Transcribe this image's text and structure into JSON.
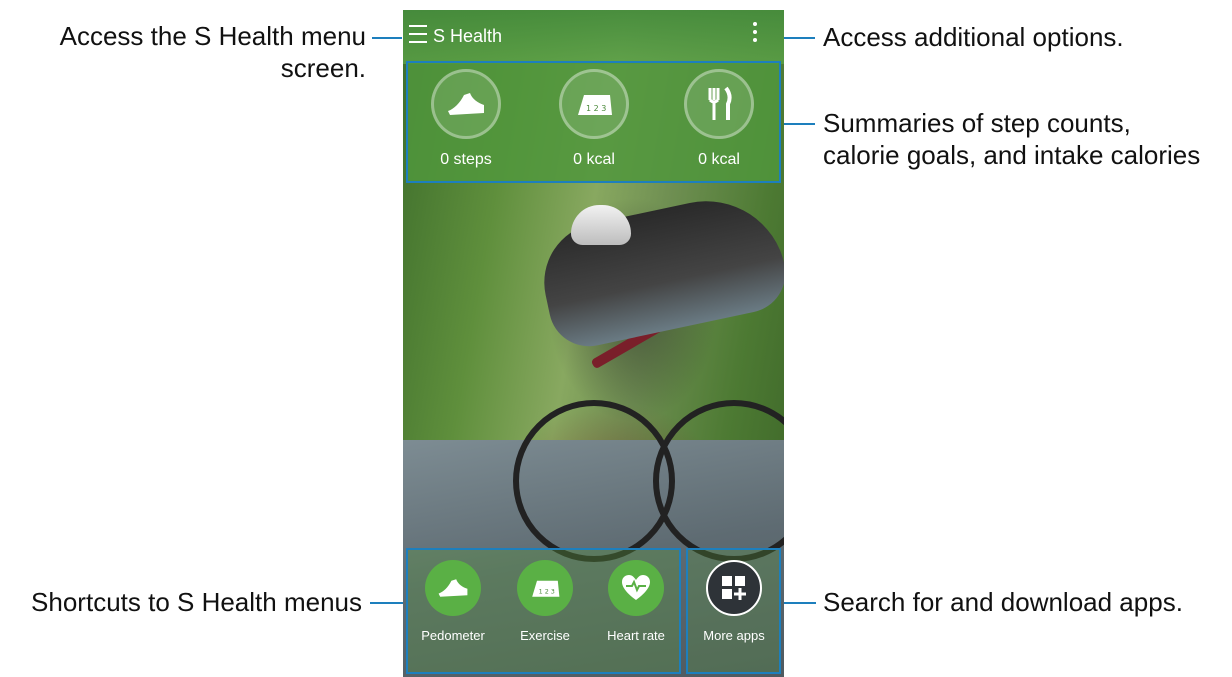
{
  "app": {
    "title": "S Health"
  },
  "summary": [
    {
      "label": "0 steps",
      "icon": "shoe-icon"
    },
    {
      "label": "0 kcal",
      "icon": "exercise-track-icon"
    },
    {
      "label": "0 kcal",
      "icon": "fork-knife-icon"
    }
  ],
  "shortcuts": [
    {
      "label": "Pedometer",
      "icon": "shoe-icon"
    },
    {
      "label": "Exercise",
      "icon": "exercise-track-icon"
    },
    {
      "label": "Heart rate",
      "icon": "heart-rate-icon"
    }
  ],
  "more_apps": {
    "label": "More apps",
    "icon": "grid-plus-icon"
  },
  "annotations": {
    "menu": "Access the S Health menu screen.",
    "menu_line1": "Access the S Health menu",
    "menu_line2": "screen.",
    "options": "Access additional options.",
    "summaries_line1": "Summaries of step counts,",
    "summaries_line2": "calorie goals, and intake calories",
    "shortcuts": "Shortcuts to S Health menus",
    "search": "Search for and download apps."
  },
  "colors": {
    "accent_line": "#1d7fbd",
    "shortcut_green": "#5ab045",
    "bar_green": "#4f9a3f"
  }
}
